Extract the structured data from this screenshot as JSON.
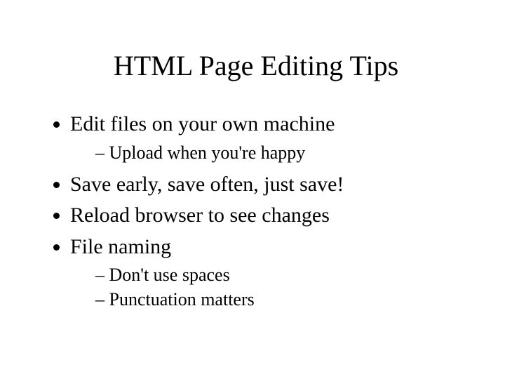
{
  "title": "HTML Page Editing Tips",
  "bullets": {
    "b1": "Edit files on your own machine",
    "b1_sub": {
      "s1": "Upload when you're happy"
    },
    "b2": "Save early, save often, just save!",
    "b3": "Reload browser to see changes",
    "b4": "File naming",
    "b4_sub": {
      "s1": "Don't use spaces",
      "s2": "Punctuation matters"
    }
  }
}
